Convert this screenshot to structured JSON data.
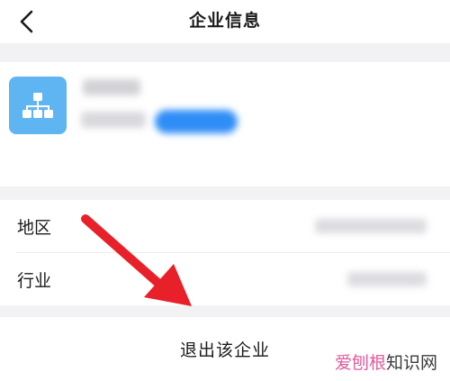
{
  "navbar": {
    "title": "企业信息",
    "back_icon": "chevron-left-icon"
  },
  "company": {
    "logo_icon": "org-chart-icon",
    "logo_color": "#5fb5f2",
    "name_blurred": "",
    "subtitle_blurred": "",
    "badge_blurred": "",
    "badge_color": "#2f8df6"
  },
  "info_rows": [
    {
      "label": "地区",
      "value_blurred": ""
    },
    {
      "label": "行业",
      "value_blurred": ""
    }
  ],
  "actions": {
    "exit_label": "退出该企业"
  },
  "annotation": {
    "type": "arrow",
    "color": "#e8202a",
    "points_to": "exit-button"
  },
  "watermark": {
    "part1": "爱刨根",
    "part2": "知识网"
  }
}
